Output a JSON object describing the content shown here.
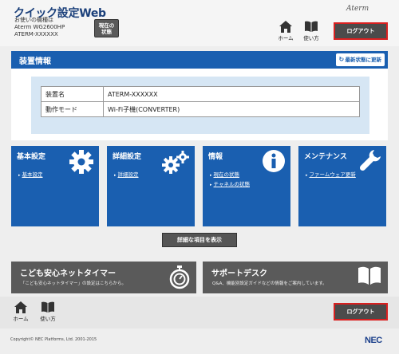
{
  "header": {
    "app_title": "クイック設定Web",
    "model_label": "お使いの機種は",
    "model_name": "Aterm WG2600HP",
    "device_id": "ATERM-XXXXXX",
    "status_button_line1": "現在の",
    "status_button_line2": "状態",
    "brand": "Aterm",
    "home_label": "ホーム",
    "help_label": "使い方",
    "logout_label": "ログアウト"
  },
  "device_panel": {
    "title": "装置情報",
    "refresh_label": "最新状態に更新",
    "rows": [
      {
        "key": "装置名",
        "value": "ATERM-XXXXXX"
      },
      {
        "key": "動作モード",
        "value": "Wi-Fi子機(CONVERTER)"
      }
    ]
  },
  "tiles": [
    {
      "title": "基本設定",
      "icon": "gear-icon",
      "links": [
        "基本設定"
      ]
    },
    {
      "title": "詳細設定",
      "icon": "gears-icon",
      "links": [
        "詳細設定"
      ]
    },
    {
      "title": "情報",
      "icon": "info-icon",
      "links": [
        "現在の状態",
        "チャネルの状態"
      ]
    },
    {
      "title": "メンテナンス",
      "icon": "wrench-icon",
      "links": [
        "ファームウェア更新"
      ]
    }
  ],
  "detail_button_label": "詳細な項目を表示",
  "kids_timer": {
    "title": "こども安心ネットタイマー",
    "subtitle": "「こども安心ネットタイマー」の設定はこちらから。"
  },
  "support_desk": {
    "title": "サポートデスク",
    "subtitle": "Q&A、機能別設定ガイドなどの情報をご案内しています。"
  },
  "footer": {
    "home_label": "ホーム",
    "help_label": "使い方",
    "logout_label": "ログアウト",
    "copyright": "Copyright© NEC Platforms, Ltd. 2001-2015",
    "company_logo": "NEC"
  },
  "colors": {
    "accent_blue": "#1a5fb0",
    "dark_gray": "#5a5a5a",
    "logout_border": "#d92020"
  }
}
